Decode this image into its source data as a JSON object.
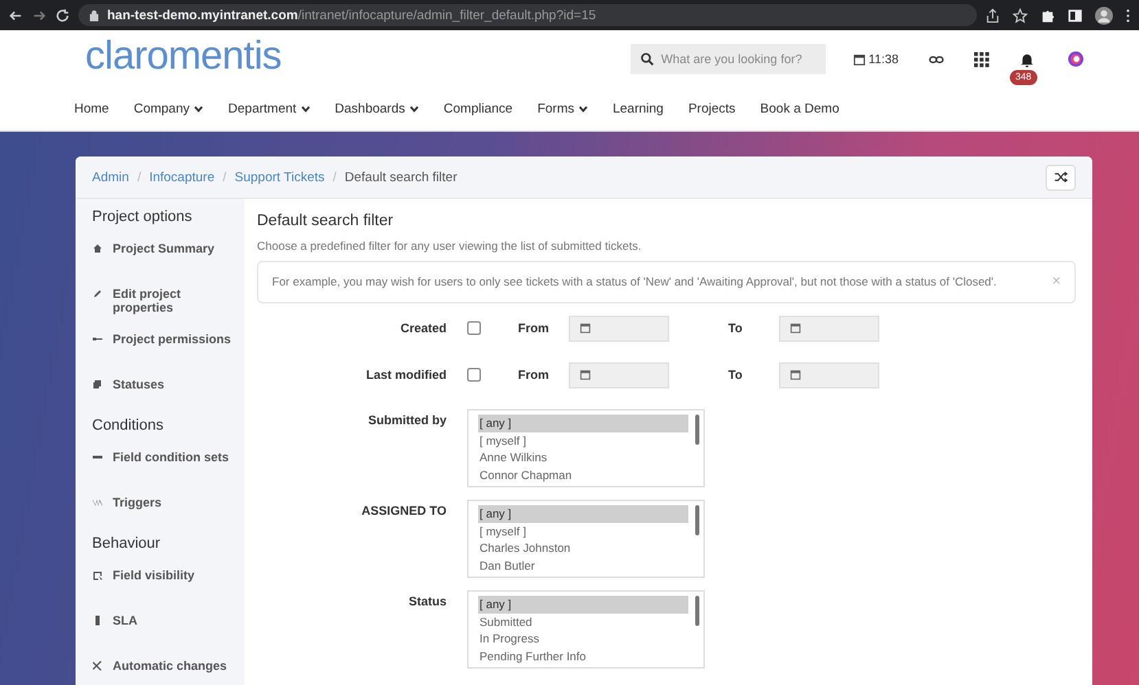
{
  "browser": {
    "url_host": "han-test-demo.myintranet.com",
    "url_path": "/intranet/infocapture/admin_filter_default.php?id=15"
  },
  "header": {
    "logo": "claromentis",
    "search": {
      "placeholder": "What are you looking for?"
    },
    "time": "11:38",
    "notification_count": "348"
  },
  "nav": [
    {
      "label": "Home",
      "dropdown": false
    },
    {
      "label": "Company",
      "dropdown": true
    },
    {
      "label": "Department",
      "dropdown": true
    },
    {
      "label": "Dashboards",
      "dropdown": true
    },
    {
      "label": "Compliance",
      "dropdown": false
    },
    {
      "label": "Forms",
      "dropdown": true
    },
    {
      "label": "Learning",
      "dropdown": false
    },
    {
      "label": "Projects",
      "dropdown": false
    },
    {
      "label": "Book a Demo",
      "dropdown": false
    }
  ],
  "breadcrumb": [
    {
      "label": "Admin",
      "link": true
    },
    {
      "separator": "/",
      "label": "Infocapture",
      "link": true
    },
    {
      "separator": "/",
      "label": "Support Tickets",
      "link": true
    },
    {
      "separator": "/",
      "label": "Default search filter",
      "link": false
    }
  ],
  "sidebar": [
    {
      "kind": "heading",
      "label": "Project options"
    },
    {
      "kind": "link",
      "label": "Project Summary"
    },
    {
      "kind": "link",
      "label": "Edit project properties"
    },
    {
      "kind": "link",
      "label": "Project permissions"
    },
    {
      "kind": "link",
      "label": "Statuses"
    },
    {
      "kind": "heading",
      "label": "Conditions"
    },
    {
      "kind": "link",
      "label": "Field condition sets"
    },
    {
      "kind": "link",
      "label": "Triggers"
    },
    {
      "kind": "heading",
      "label": "Behaviour"
    },
    {
      "kind": "link",
      "label": "Field visibility"
    },
    {
      "kind": "link",
      "label": "SLA"
    },
    {
      "kind": "link",
      "label": "Automatic changes"
    }
  ],
  "content": {
    "title": "Default search filter",
    "description": "Choose a predefined filter for any user viewing the list of submitted tickets.",
    "alert": "For example, you may wish for users to only see tickets with a status of 'New' and 'Awaiting Approval', but not those with a status of 'Closed'.",
    "alert_close": "×"
  },
  "fields": [
    {
      "kind": "date",
      "label": "Created",
      "checked": false,
      "from": "From",
      "to": "To"
    },
    {
      "kind": "date",
      "label": "Last modified",
      "checked": false,
      "from": "From",
      "to": "To"
    },
    {
      "kind": "list",
      "label": "Submitted by",
      "options": [
        {
          "label": "[ any ]",
          "selected": true
        },
        {
          "label": "[ myself ]",
          "selected": false
        },
        {
          "label": "Anne Wilkins",
          "selected": false
        },
        {
          "label": "Connor Chapman",
          "selected": false
        }
      ]
    },
    {
      "kind": "list",
      "label": "ASSIGNED TO",
      "options": [
        {
          "label": "[ any ]",
          "selected": true
        },
        {
          "label": "[ myself ]",
          "selected": false
        },
        {
          "label": "Charles Johnston",
          "selected": false
        },
        {
          "label": "Dan Butler",
          "selected": false
        }
      ]
    },
    {
      "kind": "list",
      "label": "Status",
      "options": [
        {
          "label": "[ any ]",
          "selected": true
        },
        {
          "label": "Submitted",
          "selected": false
        },
        {
          "label": "In Progress",
          "selected": false
        },
        {
          "label": "Pending Further Info",
          "selected": false
        }
      ]
    }
  ]
}
